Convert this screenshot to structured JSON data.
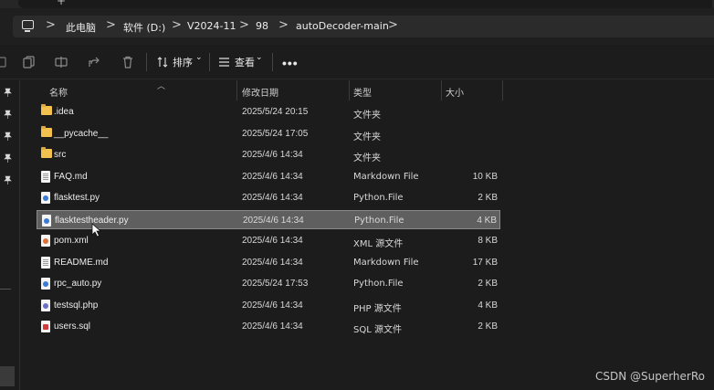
{
  "tabstrip": {
    "fragment": "+"
  },
  "address": {
    "crumbs": [
      "此电脑",
      "软件 (D:)",
      "V2024-11",
      "98",
      "autoDecoder-main"
    ],
    "separator": ">"
  },
  "toolbar": {
    "sort_label": "排序",
    "view_label": "查看",
    "more_label": "•••",
    "dropdown": "⌄"
  },
  "columns": {
    "name": "名称",
    "modified": "修改日期",
    "type": "类型",
    "size": "大小"
  },
  "files": [
    {
      "icon": "folder-icon",
      "name": ".idea",
      "date": "2025/5/24 20:15",
      "type": "文件夹",
      "size": ""
    },
    {
      "icon": "folder-icon",
      "name": "__pycache__",
      "date": "2025/5/24 17:05",
      "type": "文件夹",
      "size": ""
    },
    {
      "icon": "folder-icon",
      "name": "src",
      "date": "2025/4/6 14:34",
      "type": "文件夹",
      "size": ""
    },
    {
      "icon": "markdown-file-icon",
      "name": "FAQ.md",
      "date": "2025/4/6 14:34",
      "type": "Markdown File",
      "size": "10 KB"
    },
    {
      "icon": "python-file-icon",
      "name": "flasktest.py",
      "date": "2025/4/6 14:34",
      "type": "Python.File",
      "size": "2 KB"
    },
    {
      "icon": "python-file-icon",
      "name": "flasktestheader.py",
      "date": "2025/4/6 14:34",
      "type": "Python.File",
      "size": "4 KB",
      "selected": true
    },
    {
      "icon": "xml-file-icon",
      "name": "pom.xml",
      "date": "2025/4/6 14:34",
      "type": "XML 源文件",
      "size": "8 KB"
    },
    {
      "icon": "markdown-file-icon",
      "name": "README.md",
      "date": "2025/4/6 14:34",
      "type": "Markdown File",
      "size": "17 KB"
    },
    {
      "icon": "python-file-icon",
      "name": "rpc_auto.py",
      "date": "2025/5/24 17:53",
      "type": "Python.File",
      "size": "2 KB"
    },
    {
      "icon": "php-file-icon",
      "name": "testsql.php",
      "date": "2025/4/6 14:34",
      "type": "PHP 源文件",
      "size": "4 KB"
    },
    {
      "icon": "sql-file-icon",
      "name": "users.sql",
      "date": "2025/4/6 14:34",
      "type": "SQL 源文件",
      "size": "2 KB"
    }
  ],
  "watermark": "CSDN @SuperherRo",
  "colors": {
    "background": "#1c1c1c",
    "selection": "#5f5f5f",
    "folder": "#f2c14e",
    "python": "#3a7bd5",
    "xml": "#e0703a",
    "php": "#6a6ec8",
    "sql": "#d23b3b"
  }
}
